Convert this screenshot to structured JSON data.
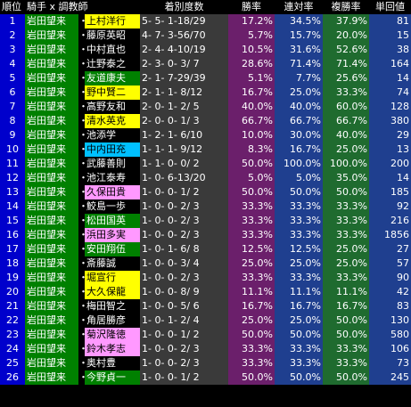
{
  "header": {
    "rank": "順位",
    "jockey_trainer": "騎手 x 調教師",
    "record": "着別度数",
    "win_rate": "勝率",
    "rentai_rate": "連対率",
    "fukusho_rate": "複勝率",
    "tansho_return": "単回値"
  },
  "colors": {
    "rank_bg": "#0000cc",
    "jockey_bg": "#008000",
    "trainer_default_bg": "#000000",
    "trainer_default_fg": "#ffffff",
    "trainer_yellow": "#ffff00",
    "trainer_green": "#008000",
    "trainer_cyan": "#00c0ff",
    "trainer_pink": "#ff99ff",
    "record_bg": "#3a3a3a",
    "win_bg": "#6b1f6b",
    "rentai_bg": "#1f3f8f",
    "fukusho_bg": "#1f6b2f",
    "tansho_bg": "#1f3f8f"
  },
  "rows": [
    {
      "rank": "1",
      "jockey": "岩田望来",
      "sep": "・",
      "trainer": "上村洋行",
      "trainer_color": "yellow",
      "record": "5- 5- 1-18/29",
      "win": "17.2%",
      "rentai": "34.5%",
      "fukusho": "37.9%",
      "tansho": "81"
    },
    {
      "rank": "2",
      "jockey": "岩田望来",
      "sep": "・",
      "trainer": "藤原英昭",
      "trainer_color": "default",
      "record": "4- 7- 3-56/70",
      "win": "5.7%",
      "rentai": "15.7%",
      "fukusho": "20.0%",
      "tansho": "15"
    },
    {
      "rank": "3",
      "jockey": "岩田望来",
      "sep": "・",
      "trainer": "中村直也",
      "trainer_color": "default",
      "record": "2- 4- 4-10/19",
      "win": "10.5%",
      "rentai": "31.6%",
      "fukusho": "52.6%",
      "tansho": "38"
    },
    {
      "rank": "4",
      "jockey": "岩田望来",
      "sep": "・",
      "trainer": "辻野泰之",
      "trainer_color": "default",
      "record": "2- 3- 0- 3/ 7",
      "win": "28.6%",
      "rentai": "71.4%",
      "fukusho": "71.4%",
      "tansho": "164"
    },
    {
      "rank": "5",
      "jockey": "岩田望来",
      "sep": "・",
      "trainer": "友道康夫",
      "trainer_color": "green",
      "record": "2- 1- 7-29/39",
      "win": "5.1%",
      "rentai": "7.7%",
      "fukusho": "25.6%",
      "tansho": "14"
    },
    {
      "rank": "6",
      "jockey": "岩田望来",
      "sep": "・",
      "trainer": "野中賢二",
      "trainer_color": "yellow",
      "record": "2- 1- 1- 8/12",
      "win": "16.7%",
      "rentai": "25.0%",
      "fukusho": "33.3%",
      "tansho": "74"
    },
    {
      "rank": "7",
      "jockey": "岩田望来",
      "sep": "・",
      "trainer": "高野友和",
      "trainer_color": "default",
      "record": "2- 0- 1- 2/ 5",
      "win": "40.0%",
      "rentai": "40.0%",
      "fukusho": "60.0%",
      "tansho": "128"
    },
    {
      "rank": "8",
      "jockey": "岩田望来",
      "sep": "・",
      "trainer": "清水英克",
      "trainer_color": "yellow",
      "record": "2- 0- 0- 1/ 3",
      "win": "66.7%",
      "rentai": "66.7%",
      "fukusho": "66.7%",
      "tansho": "380"
    },
    {
      "rank": "9",
      "jockey": "岩田望来",
      "sep": "・",
      "trainer": "池添学",
      "trainer_color": "default",
      "record": "1- 2- 1- 6/10",
      "win": "10.0%",
      "rentai": "30.0%",
      "fukusho": "40.0%",
      "tansho": "29"
    },
    {
      "rank": "10",
      "jockey": "岩田望来",
      "sep": "・",
      "trainer": "中内田充",
      "trainer_color": "cyan",
      "record": "1- 1- 1- 9/12",
      "win": "8.3%",
      "rentai": "16.7%",
      "fukusho": "25.0%",
      "tansho": "13"
    },
    {
      "rank": "11",
      "jockey": "岩田望来",
      "sep": "・",
      "trainer": "武藤善則",
      "trainer_color": "default",
      "record": "1- 1- 0- 0/ 2",
      "win": "50.0%",
      "rentai": "100.0%",
      "fukusho": "100.0%",
      "tansho": "200"
    },
    {
      "rank": "12",
      "jockey": "岩田望来",
      "sep": "・",
      "trainer": "池江泰寿",
      "trainer_color": "default",
      "record": "1- 0- 6-13/20",
      "win": "5.0%",
      "rentai": "5.0%",
      "fukusho": "35.0%",
      "tansho": "14"
    },
    {
      "rank": "13",
      "jockey": "岩田望来",
      "sep": "・",
      "trainer": "久保田貴",
      "trainer_color": "pink",
      "record": "1- 0- 0- 1/ 2",
      "win": "50.0%",
      "rentai": "50.0%",
      "fukusho": "50.0%",
      "tansho": "185"
    },
    {
      "rank": "14",
      "jockey": "岩田望来",
      "sep": "・",
      "trainer": "鮫島一歩",
      "trainer_color": "default",
      "record": "1- 0- 0- 2/ 3",
      "win": "33.3%",
      "rentai": "33.3%",
      "fukusho": "33.3%",
      "tansho": "92"
    },
    {
      "rank": "15",
      "jockey": "岩田望来",
      "sep": "・",
      "trainer": "松田国英",
      "trainer_color": "green",
      "record": "1- 0- 0- 2/ 3",
      "win": "33.3%",
      "rentai": "33.3%",
      "fukusho": "33.3%",
      "tansho": "216"
    },
    {
      "rank": "16",
      "jockey": "岩田望来",
      "sep": "・",
      "trainer": "浜田多実",
      "trainer_color": "pink",
      "record": "1- 0- 0- 2/ 3",
      "win": "33.3%",
      "rentai": "33.3%",
      "fukusho": "33.3%",
      "tansho": "1856"
    },
    {
      "rank": "17",
      "jockey": "岩田望来",
      "sep": "・",
      "trainer": "安田翔伍",
      "trainer_color": "green",
      "record": "1- 0- 1- 6/ 8",
      "win": "12.5%",
      "rentai": "12.5%",
      "fukusho": "25.0%",
      "tansho": "27"
    },
    {
      "rank": "18",
      "jockey": "岩田望来",
      "sep": "・",
      "trainer": "斎藤誠",
      "trainer_color": "default",
      "record": "1- 0- 0- 3/ 4",
      "win": "25.0%",
      "rentai": "25.0%",
      "fukusho": "25.0%",
      "tansho": "57"
    },
    {
      "rank": "19",
      "jockey": "岩田望来",
      "sep": "・",
      "trainer": "堀宣行",
      "trainer_color": "yellow",
      "record": "1- 0- 0- 2/ 3",
      "win": "33.3%",
      "rentai": "33.3%",
      "fukusho": "33.3%",
      "tansho": "90"
    },
    {
      "rank": "20",
      "jockey": "岩田望来",
      "sep": "・",
      "trainer": "大久保龍",
      "trainer_color": "yellow",
      "record": "1- 0- 0- 8/ 9",
      "win": "11.1%",
      "rentai": "11.1%",
      "fukusho": "11.1%",
      "tansho": "42"
    },
    {
      "rank": "21",
      "jockey": "岩田望来",
      "sep": "・",
      "trainer": "梅田智之",
      "trainer_color": "default",
      "record": "1- 0- 0- 5/ 6",
      "win": "16.7%",
      "rentai": "16.7%",
      "fukusho": "16.7%",
      "tansho": "83"
    },
    {
      "rank": "22",
      "jockey": "岩田望来",
      "sep": "・",
      "trainer": "角居勝彦",
      "trainer_color": "default",
      "record": "1- 0- 1- 2/ 4",
      "win": "25.0%",
      "rentai": "25.0%",
      "fukusho": "50.0%",
      "tansho": "130"
    },
    {
      "rank": "23",
      "jockey": "岩田望来",
      "sep": "・",
      "trainer": "菊沢隆徳",
      "trainer_color": "pink",
      "record": "1- 0- 0- 1/ 2",
      "win": "50.0%",
      "rentai": "50.0%",
      "fukusho": "50.0%",
      "tansho": "580"
    },
    {
      "rank": "24",
      "jockey": "岩田望来",
      "sep": "・",
      "trainer": "鈴木孝志",
      "trainer_color": "pink",
      "record": "1- 0- 0- 2/ 3",
      "win": "33.3%",
      "rentai": "33.3%",
      "fukusho": "33.3%",
      "tansho": "106"
    },
    {
      "rank": "25",
      "jockey": "岩田望来",
      "sep": "・",
      "trainer": "奥村豊",
      "trainer_color": "default",
      "record": "1- 0- 0- 2/ 3",
      "win": "33.3%",
      "rentai": "33.3%",
      "fukusho": "33.3%",
      "tansho": "73"
    },
    {
      "rank": "26",
      "jockey": "岩田望来",
      "sep": "・",
      "trainer": "今野貞一",
      "trainer_color": "green",
      "record": "1- 0- 0- 1/ 2",
      "win": "50.0%",
      "rentai": "50.0%",
      "fukusho": "50.0%",
      "tansho": "245"
    }
  ]
}
